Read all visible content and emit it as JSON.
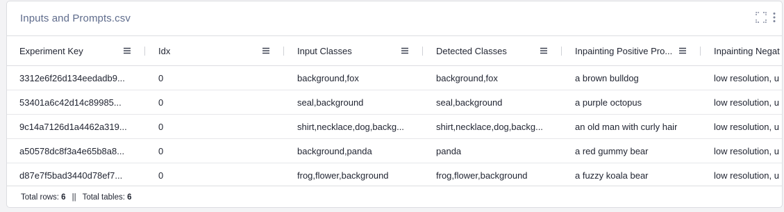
{
  "panel": {
    "title": "Inputs and Prompts.csv"
  },
  "table": {
    "columns": [
      {
        "label": "Experiment Key"
      },
      {
        "label": "Idx"
      },
      {
        "label": "Input Classes"
      },
      {
        "label": "Detected Classes"
      },
      {
        "label": "Inpainting Positive Pro..."
      },
      {
        "label": "Inpainting Negat"
      }
    ],
    "rows": [
      [
        "3312e6f26d134eedadb9...",
        "0",
        "background,fox",
        "background,fox",
        "a brown bulldog",
        "low resolution, u"
      ],
      [
        "53401a6c42d14c89985...",
        "0",
        "seal,background",
        "seal,background",
        "a purple octopus",
        "low resolution, u"
      ],
      [
        "9c14a7126d1a4462a319...",
        "0",
        "shirt,necklace,dog,backg...",
        "shirt,necklace,dog,backg...",
        "an old man with curly hair",
        "low resolution, u"
      ],
      [
        "a50578dc8f3a4e65b8a8...",
        "0",
        "background,panda",
        "panda",
        "a red gummy bear",
        "low resolution, u"
      ],
      [
        "d87e7f5bad3440d78ef7...",
        "0",
        "frog,flower,background",
        "frog,flower,background",
        "a fuzzy koala bear",
        "low resolution, u"
      ]
    ]
  },
  "footer": {
    "total_rows_label": "Total rows:",
    "total_rows_value": "6",
    "separator": "||",
    "total_tables_label": "Total tables:",
    "total_tables_value": "6"
  },
  "icons": {
    "fullscreen": "fullscreen-icon",
    "more": "more-vertical-icon",
    "column_menu": "hamburger-menu-icon"
  },
  "colors": {
    "title": "#5f6c8c",
    "text": "#1f2330",
    "border": "#dcdde1"
  }
}
